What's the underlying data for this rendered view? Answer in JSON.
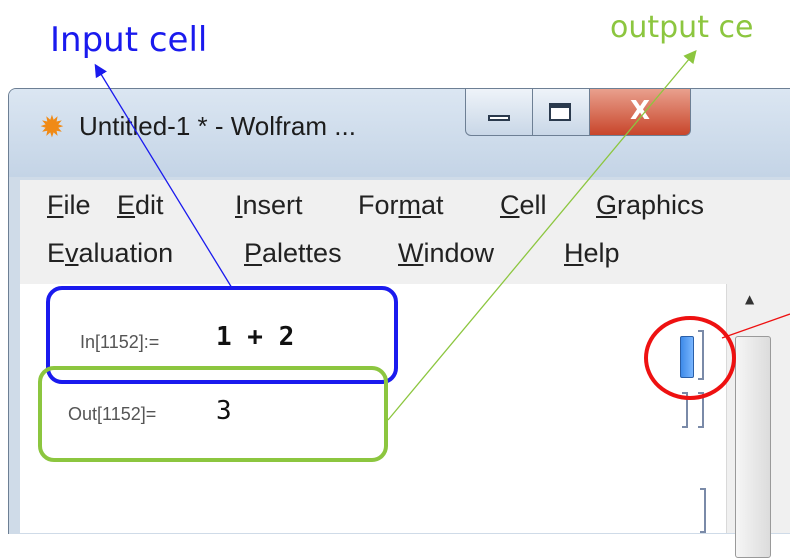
{
  "annotations": {
    "input_label": "Input cell",
    "output_label": "output ce",
    "input_color": "#1a1aee",
    "output_color": "#8cc63f",
    "highlight_color": "#ee1111"
  },
  "window": {
    "title": "Untitled-1 * - Wolfram ...",
    "app_icon": "wolfram-star-icon",
    "close_glyph": "X"
  },
  "menu": {
    "row1": [
      {
        "pre": "",
        "key": "F",
        "post": "ile"
      },
      {
        "pre": "",
        "key": "E",
        "post": "dit"
      },
      {
        "pre": "",
        "key": "I",
        "post": "nsert"
      },
      {
        "pre": "For",
        "key": "m",
        "post": "at"
      },
      {
        "pre": "",
        "key": "C",
        "post": "ell"
      },
      {
        "pre": "",
        "key": "G",
        "post": "raphics"
      }
    ],
    "row2": [
      {
        "pre": "E",
        "key": "v",
        "post": "aluation"
      },
      {
        "pre": "",
        "key": "P",
        "post": "alettes"
      },
      {
        "pre": "",
        "key": "W",
        "post": "indow"
      },
      {
        "pre": "",
        "key": "H",
        "post": "elp"
      }
    ]
  },
  "notebook": {
    "input_label": "In[1152]:=",
    "input_value": "1 + 2",
    "output_label": "Out[1152]=",
    "output_value": "3"
  }
}
